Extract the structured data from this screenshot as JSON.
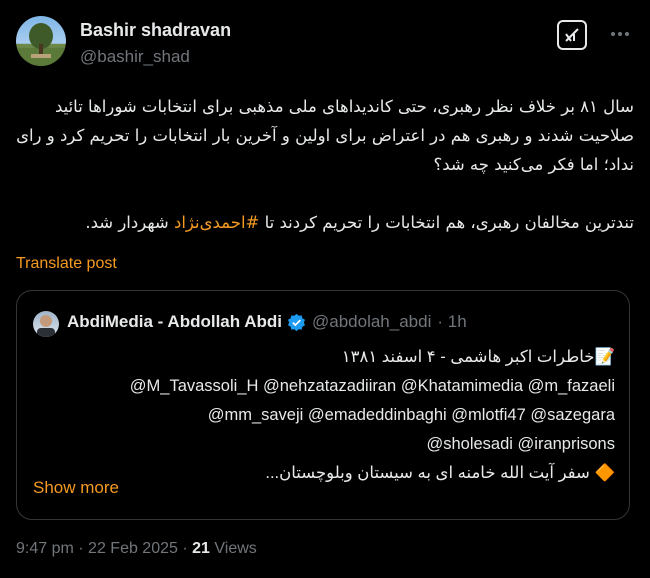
{
  "author": {
    "display_name": "Bashir shadravan",
    "handle": "@bashir_shad"
  },
  "tweet": {
    "paragraph1": "سال ۸۱ بر خلاف نظر رهبری، حتی کاندیداهای ملی مذهبی برای انتخابات شوراها تائید صلاحیت شدند و رهبری هم در اعتراض برای اولین و آخرین بار انتخابات را تحریم کرد و رای نداد؛ اما فکر می‌کنید چه شد؟",
    "paragraph2_before": "تندترین مخالفان رهبری، هم انتخابات را تحریم کردند تا ",
    "hashtag": "#احمدی‌نژاد",
    "paragraph2_after": " شهردار شد.",
    "translate_label": "Translate post"
  },
  "quote": {
    "display_name": "AbdiMedia - Abdollah Abdi",
    "handle": "@abdolah_abdi",
    "time": "· 1h",
    "line1": "📝خاطرات اکبر هاشمی - ۴ اسفند ۱۳۸۱",
    "mentions1": "@M_Tavassoli_H @nehzatazadiiran @Khatamimedia @m_fazaeli",
    "mentions2": "@mm_saveji @emadeddinbaghi @mlotfi47 @sazegara",
    "mentions3": "@sholesadi @iranprisons",
    "line5": "🔶 سفر آیت الله خامنه ای به سیستان وبلوچستان...",
    "show_more": "Show more"
  },
  "meta": {
    "time": "9:47 pm",
    "separator": "·",
    "date": "22 Feb 2025",
    "views_count": "21",
    "views_label": "Views"
  },
  "colors": {
    "accent": "#f59a23",
    "muted": "#71767b",
    "text": "#e7e9ea",
    "verified": "#1d9bf0"
  },
  "icons": {
    "grok": "grok-icon",
    "more": "more-options-icon",
    "verified": "verified-badge-icon"
  }
}
